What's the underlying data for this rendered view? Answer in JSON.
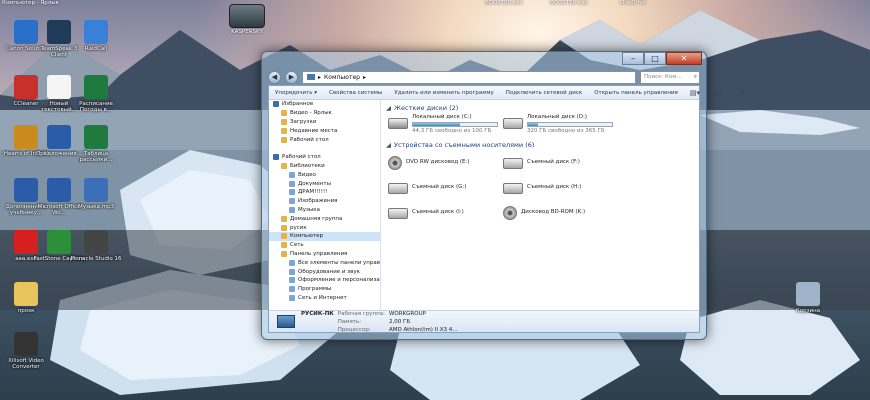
{
  "top_labels": [
    "Компьютер - Ярлык",
    "BOOSTER.exe",
    "BOOSTER.exe",
    "OneDrive"
  ],
  "kaspersky": {
    "label": "KASPERSKY"
  },
  "desktop_icons": [
    {
      "label": "Canon Soluti...",
      "icon": "canon-icon",
      "color": "#2a70c8"
    },
    {
      "label": "TeamSpeak 3 Client",
      "icon": "teamspeak-icon",
      "color": "#1f3b59"
    },
    {
      "label": "RaidCall",
      "icon": "raidcall-icon",
      "color": "#3a80d8"
    },
    {
      "label": "CCleaner",
      "icon": "ccleaner-icon",
      "color": "#c9302c"
    },
    {
      "label": "Новый текстовый...",
      "icon": "text-file-icon",
      "color": "#f5f5f5"
    },
    {
      "label": "Расписание Погоды в...",
      "icon": "excel-file-icon",
      "color": "#1f7a3f"
    },
    {
      "label": "Hearts of Iron III",
      "icon": "hoi3-icon",
      "color": "#c98a1e"
    },
    {
      "label": "Предложения...",
      "icon": "word-file-icon",
      "color": "#2b5ca8"
    },
    {
      "label": "Таблица рассылки...",
      "icon": "excel-file-icon",
      "color": "#1f7a3f"
    },
    {
      "label": "Дополнения к учебнику...",
      "icon": "word-file-icon",
      "color": "#2b5ca8"
    },
    {
      "label": "Microsoft Office Wo...",
      "icon": "word-icon",
      "color": "#2b5ca8"
    },
    {
      "label": "Музыка.mp3",
      "icon": "audio-file-icon",
      "color": "#3d6fb8"
    },
    {
      "label": "aaa.exe",
      "icon": "opera-icon",
      "color": "#d62020"
    },
    {
      "label": "FastStone Capture",
      "icon": "faststone-icon",
      "color": "#2d8f3a"
    },
    {
      "label": "Pinnacle Studio 16",
      "icon": "pinnacle-icon",
      "color": "#444"
    },
    {
      "label": "проэк",
      "icon": "folder-icon",
      "color": "#e8c45c"
    },
    {
      "label": "Xilisoft Video Converter",
      "icon": "video-converter-icon",
      "color": "#333"
    },
    {
      "label": "Корзина",
      "icon": "recycle-bin-icon",
      "color": "#9fb4c8"
    }
  ],
  "window": {
    "address": "Компьютер",
    "search_placeholder": "Поиск: Ком...",
    "toolbar": [
      "Упорядочить ▾",
      "Свойства системы",
      "Удалить или изменить программу",
      "Подключить сетевой диск",
      "Открыть панель управления"
    ],
    "nav": [
      {
        "label": "Избранное",
        "icon": "star-icon",
        "level": 0
      },
      {
        "label": "Видео - Ярлык",
        "icon": "shortcut-icon",
        "level": 1
      },
      {
        "label": "Загрузки",
        "icon": "downloads-icon",
        "level": 1
      },
      {
        "label": "Недавние места",
        "icon": "recent-icon",
        "level": 1
      },
      {
        "label": "Рабочий стол",
        "icon": "desktop-icon",
        "level": 1
      },
      {
        "label": "",
        "icon": "",
        "level": 0
      },
      {
        "label": "Рабочий стол",
        "icon": "desktop-icon",
        "level": 0
      },
      {
        "label": "Библиотеки",
        "icon": "library-icon",
        "level": 1
      },
      {
        "label": "Видео",
        "icon": "video-icon",
        "level": 2
      },
      {
        "label": "Документы",
        "icon": "documents-icon",
        "level": 2
      },
      {
        "label": "ДРАМ!!!!!!",
        "icon": "folder-icon",
        "level": 2
      },
      {
        "label": "Изображения",
        "icon": "pictures-icon",
        "level": 2
      },
      {
        "label": "Музыка",
        "icon": "music-icon",
        "level": 2
      },
      {
        "label": "Домашняя группа",
        "icon": "homegroup-icon",
        "level": 1
      },
      {
        "label": "русик",
        "icon": "user-icon",
        "level": 1
      },
      {
        "label": "Компьютер",
        "icon": "computer-icon",
        "level": 1,
        "selected": true
      },
      {
        "label": "Сеть",
        "icon": "network-icon",
        "level": 1
      },
      {
        "label": "Панель управления",
        "icon": "control-panel-icon",
        "level": 1
      },
      {
        "label": "Все элементы панели управлен",
        "icon": "control-panel-icon",
        "level": 2
      },
      {
        "label": "Оборудование и звук",
        "icon": "hardware-icon",
        "level": 2
      },
      {
        "label": "Оформление и персонализация",
        "icon": "personalization-icon",
        "level": 2
      },
      {
        "label": "Программы",
        "icon": "programs-icon",
        "level": 2
      },
      {
        "label": "Сеть и Интернет",
        "icon": "network-icon",
        "level": 2
      }
    ],
    "hard_disks": {
      "title": "Жесткие диски (2)",
      "items": [
        {
          "name": "Локальный диск (C:)",
          "free": "44,3 ГБ свободно из 100 ГБ",
          "fill": 0.56,
          "icon": "os-disk-icon"
        },
        {
          "name": "Локальный диск (D:)",
          "free": "320 ГБ свободно из 365 ГБ",
          "fill": 0.12,
          "icon": "disk-icon"
        }
      ]
    },
    "removable": {
      "title": "Устройства со съемными носителями (6)",
      "items": [
        {
          "name": "DVD RW дисковод (E:)",
          "icon": "dvd-icon"
        },
        {
          "name": "Съемный диск (F:)",
          "icon": "removable-disk-icon"
        },
        {
          "name": "Съемный диск (G:)",
          "icon": "removable-disk-icon"
        },
        {
          "name": "Съемный диск (H:)",
          "icon": "removable-disk-icon"
        },
        {
          "name": "Съемный диск (I:)",
          "icon": "removable-disk-icon"
        },
        {
          "name": "Дисковод BD-ROM (K:)",
          "icon": "bd-rom-icon"
        }
      ]
    },
    "status": {
      "computer": "РУСИК-ПК",
      "workgroup_key": "Рабочая группа:",
      "workgroup": "WORKGROUP",
      "memory_key": "Память:",
      "memory": "2,00 ГБ",
      "cpu_key": "Процессор:",
      "cpu": "AMD Athlon(tm) II X3 4..."
    }
  }
}
